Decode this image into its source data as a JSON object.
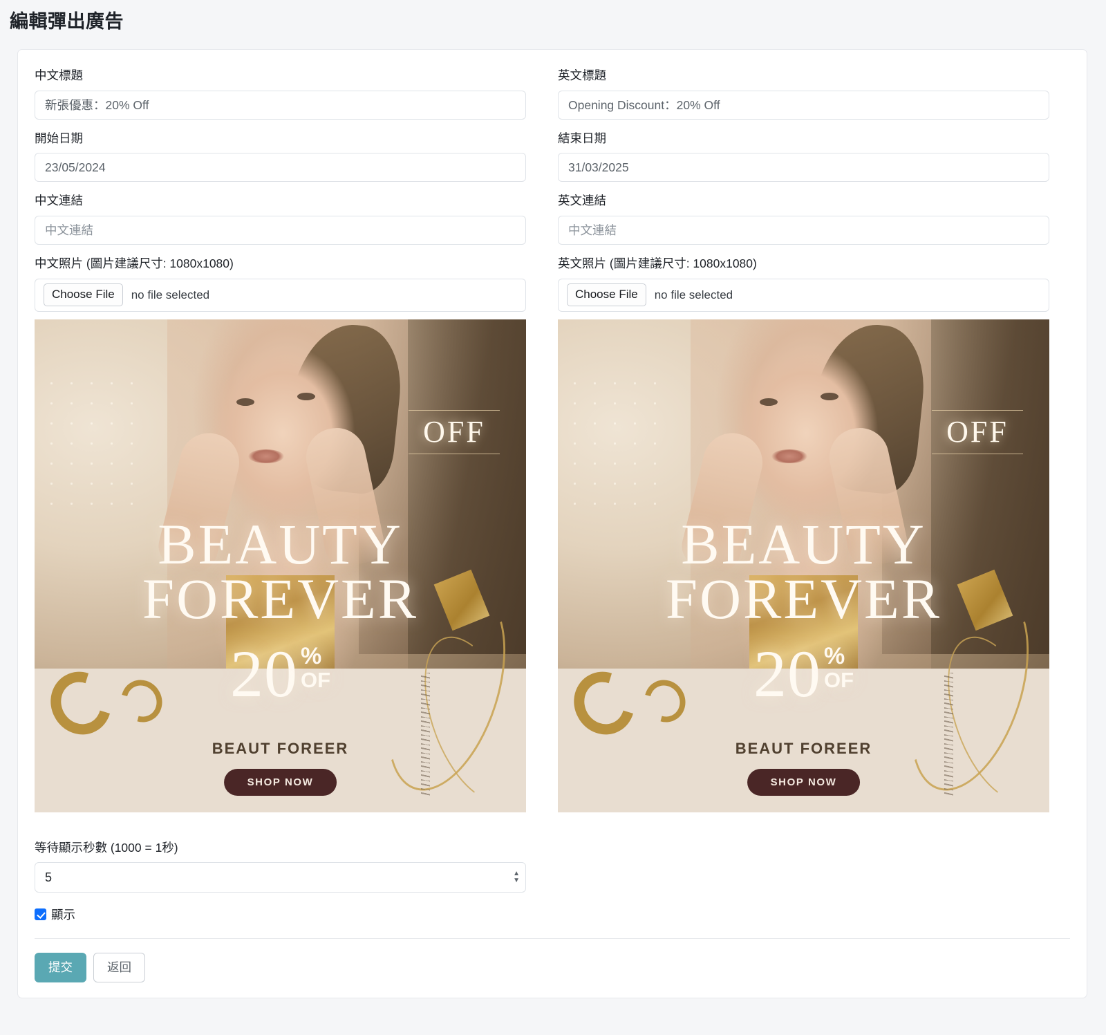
{
  "page": {
    "title": "編輯彈出廣告"
  },
  "form": {
    "zh_title": {
      "label": "中文標題",
      "value": "新張優惠：20% Off"
    },
    "en_title": {
      "label": "英文標題",
      "value": "Opening Discount：20% Off"
    },
    "start_date": {
      "label": "開始日期",
      "value": "23/05/2024"
    },
    "end_date": {
      "label": "結束日期",
      "value": "31/03/2025"
    },
    "zh_link": {
      "label": "中文連結",
      "placeholder": "中文連結",
      "value": ""
    },
    "en_link": {
      "label": "英文連結",
      "placeholder": "中文連結",
      "value": ""
    },
    "zh_photo": {
      "label": "中文照片 (圖片建議尺寸: 1080x1080)",
      "choose_label": "Choose File",
      "status": "no file selected"
    },
    "en_photo": {
      "label": "英文照片 (圖片建議尺寸: 1080x1080)",
      "choose_label": "Choose File",
      "status": "no file selected"
    },
    "delay": {
      "label": "等待顯示秒數 (1000 = 1秒)",
      "value": "5"
    },
    "show": {
      "label": "顯示",
      "checked": true
    }
  },
  "preview_ad": {
    "off_badge": "OFF",
    "headline_line1": "BEAUTY",
    "headline_line2": "FOREVER",
    "percent_number": "20",
    "percent_symbol": "%",
    "percent_off": "OF",
    "brand": "BEAUT FOREER",
    "cta": "SHOP NOW"
  },
  "actions": {
    "submit": "提交",
    "back": "返回"
  },
  "colors": {
    "primary": "#5aa8b3",
    "checkbox": "#0d6efd",
    "page_bg": "#f5f6f8",
    "card_bg": "#ffffff",
    "border": "#dfe3e8"
  },
  "icons": {
    "spinner_up": "▲",
    "spinner_down": "▼"
  }
}
